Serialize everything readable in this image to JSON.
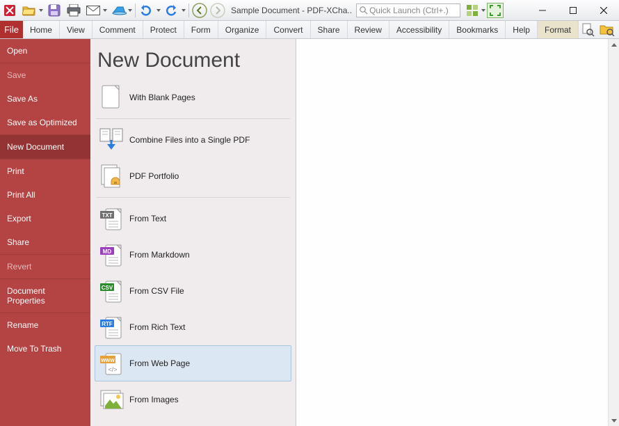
{
  "titlebar": {
    "title": "Sample Document - PDF-XCha..",
    "quick_launch_placeholder": "Quick Launch (Ctrl+.)"
  },
  "ribbon": {
    "file": "File",
    "tabs": [
      "Home",
      "View",
      "Comment",
      "Protect",
      "Form",
      "Organize",
      "Convert",
      "Share",
      "Review",
      "Accessibility",
      "Bookmarks",
      "Help"
    ],
    "format": "Format"
  },
  "sidebar": {
    "items": [
      {
        "label": "Open",
        "state": "normal"
      },
      {
        "divider": true
      },
      {
        "label": "Save",
        "state": "disabled"
      },
      {
        "label": "Save As",
        "state": "normal"
      },
      {
        "label": "Save as Optimized",
        "state": "normal"
      },
      {
        "divider": true
      },
      {
        "label": "New Document",
        "state": "selected"
      },
      {
        "divider": true
      },
      {
        "label": "Print",
        "state": "normal"
      },
      {
        "label": "Print All",
        "state": "normal"
      },
      {
        "label": "Export",
        "state": "normal"
      },
      {
        "label": "Share",
        "state": "normal"
      },
      {
        "divider": true
      },
      {
        "label": "Revert",
        "state": "disabled"
      },
      {
        "divider": true
      },
      {
        "label": "Document Properties",
        "state": "normal"
      },
      {
        "divider": true
      },
      {
        "label": "Rename",
        "state": "normal"
      },
      {
        "label": "Move To Trash",
        "state": "normal"
      }
    ]
  },
  "panel": {
    "title": "New Document",
    "groups": [
      {
        "items": [
          {
            "label": "With Blank Pages",
            "icon": "blank"
          }
        ]
      },
      {
        "items": [
          {
            "label": "Combine Files into a Single PDF",
            "icon": "combine"
          },
          {
            "label": "PDF Portfolio",
            "icon": "portfolio"
          }
        ]
      },
      {
        "items": [
          {
            "label": "From Text",
            "icon": "TXT",
            "badge": "#6f6f6f"
          },
          {
            "label": "From Markdown",
            "icon": "MD",
            "badge": "#9b3fbf"
          },
          {
            "label": "From CSV File",
            "icon": "CSV",
            "badge": "#2b8a2b"
          },
          {
            "label": "From Rich Text",
            "icon": "RTF",
            "badge": "#2a7de1"
          },
          {
            "label": "From Web Page",
            "icon": "WWW",
            "badge": "#e8a03a",
            "hovered": true
          },
          {
            "label": "From Images",
            "icon": "image"
          }
        ]
      }
    ]
  }
}
